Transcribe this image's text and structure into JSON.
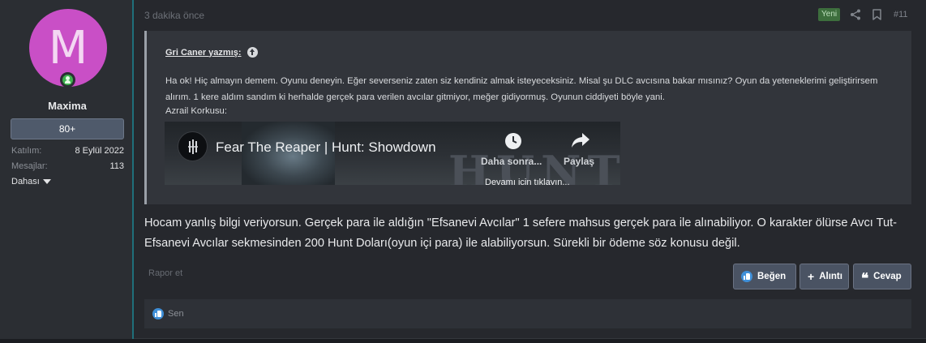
{
  "user": {
    "avatar_letter": "M",
    "username": "Maxima",
    "banner": "80+",
    "stats": [
      {
        "label": "Katılım:",
        "value": "8 Eylül 2022"
      },
      {
        "label": "Mesajlar:",
        "value": "113"
      }
    ],
    "more_label": "Dahası"
  },
  "header": {
    "time": "3 dakika önce",
    "badge": "Yeni",
    "post_number": "#11"
  },
  "quote": {
    "author_line": "Gri Caner yazmış:",
    "text": "Ha ok! Hiç almayın demem. Oyunu deneyin. Eğer severseniz zaten siz kendiniz almak isteyeceksiniz. Misal şu DLC avcısına bakar mısınız? Oyun da yeteneklerimi geliştirirsem alırım. 1 kere aldım sandım ki herhalde gerçek para verilen avcılar gitmiyor, meğer gidiyormuş. Oyunun ciddiyeti böyle yani.",
    "label": "Azrail Korkusu:",
    "video": {
      "title": "Fear The Reaper | Hunt: Showdown",
      "later": "Daha sonra...",
      "share": "Paylaş",
      "expand": "Devamı için tıklayın...",
      "bg_text": "HUNT"
    }
  },
  "body": "Hocam yanlış bilgi veriyorsun. Gerçek para ile aldığın \"Efsanevi Avcılar\" 1 sefere mahsus gerçek para ile alınabiliyor. O karakter ölürse Avcı Tut-Efsanevi Avcılar sekmesinden 200 Hunt Doları(oyun içi para) ile alabiliyorsun. Sürekli bir ödeme söz konusu değil.",
  "actions": {
    "report": "Rapor et",
    "like": "Beğen",
    "quote": "Alıntı",
    "reply": "Cevap"
  },
  "reactions": {
    "who": "Sen"
  },
  "colors": {
    "avatar": "#c94fc6",
    "online": "#3fb24f",
    "like": "#3f8fd8",
    "badge": "#3d6e3d"
  }
}
